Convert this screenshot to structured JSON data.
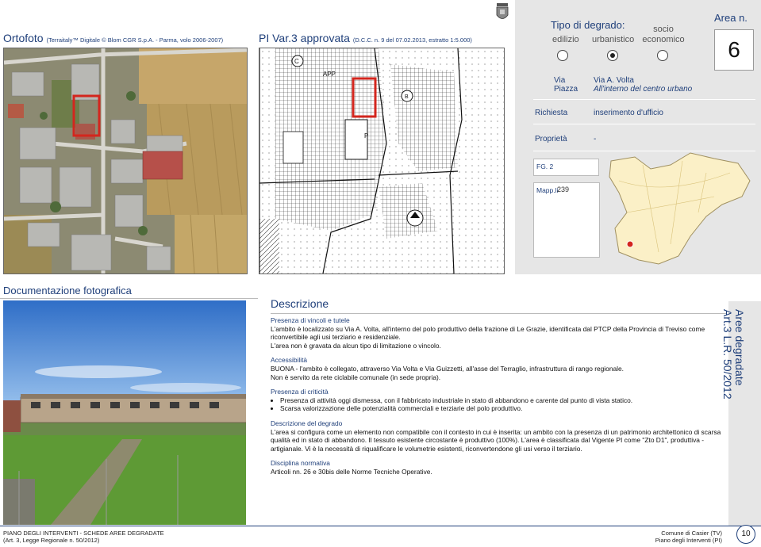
{
  "header": {
    "ortofoto_title": "Ortofoto",
    "ortofoto_sub": "(Terraitaly™ Digitale © Blom CGR S.p.A. - Parma, volo 2006-2007)",
    "pi_title": "PI Var.3 approvata",
    "pi_sub": "(D.C.C. n. 9 del 07.02.2013, estratto 1:5.000)"
  },
  "degrado": {
    "title": "Tipo di degrado:",
    "options": [
      "edilizio",
      "urbanistico",
      "socio\neconomico"
    ],
    "selected_index": 1
  },
  "area": {
    "label": "Area  n.",
    "number": "6"
  },
  "info": {
    "via_label": "Via",
    "piazza_label": "Piazza",
    "via_value": "Via A. Volta",
    "piazza_value": "All'interno del centro urbano",
    "richiesta_label": "Richiesta",
    "richiesta_value": "inserimento d'ufficio",
    "proprieta_label": "Proprietà",
    "proprieta_value": "-",
    "fg_label": "FG. 2",
    "mapp_label": "Mapp.li",
    "mapp_value": "239"
  },
  "sections": {
    "documentazione": "Documentazione fotografica",
    "descrizione": "Descrizione"
  },
  "description": {
    "vincoli_head": "Presenza di vincoli e tutele",
    "vincoli_text": "L'ambito è localizzato su Via A. Volta, all'interno del polo produttivo della frazione di Le Grazie, identificata dal PTCP della Provincia di Treviso come riconvertibile agli usi terziario e residenziale.",
    "vincoli_text2": "L'area non è gravata da alcun tipo di limitazione o vincolo.",
    "accessibilita_head": "Accessibilità",
    "accessibilita_text": "BUONA - l'ambito è collegato, attraverso Via Volta e Via Guizzetti, all'asse del Terraglio, infrastruttura di rango regionale.",
    "accessibilita_text2": "Non è servito da rete ciclabile comunale (in sede propria).",
    "criticita_head": "Presenza di criticità",
    "criticita_items": [
      "Presenza di attività oggi dismessa, con il fabbricato industriale in stato di abbandono e carente dal punto di vista statico.",
      "Scarsa valorizzazione delle potenzialità commerciali e terziarie del polo produttivo."
    ],
    "degrado_head": "Descrizione del degrado",
    "degrado_text": "L'area si configura come un elemento non compatibile con il contesto in cui è inserita: un ambito con la presenza di un patrimonio architettonico di scarsa qualità ed in stato di abbandono. Il tessuto esistente circostante è produttivo (100%). L'area è classificata dal Vigente PI come \"Zto D1\", produttiva - artigianale. Vi è la necessità di riqualificare le volumetrie esistenti, riconvertendone gli usi verso il terziario.",
    "disciplina_head": "Disciplina normativa",
    "disciplina_text": "Articoli nn. 26 e 30bis delle Norme Tecniche Operative."
  },
  "vertical_title": {
    "line1": "Aree degradate",
    "line2": "Art.3 L.R. 50/2012"
  },
  "map_labels": {
    "app": "APP",
    "c": "C",
    "b": "B",
    "p": "P"
  },
  "footer": {
    "left_title": "PIANO DEGLI INTERVENTI - SCHEDE AREE DEGRADATE",
    "left_sub": "(Art. 3, Legge Regionale n. 50/2012)",
    "right_title": "Comune di Casier (TV)",
    "right_sub": "Piano degli Interventi (PI)",
    "page": "10"
  },
  "colors": {
    "accent_blue": "#1f3f7a",
    "highlight_red": "#d3261e",
    "panel_grey": "#e6e6e6",
    "territory_fill": "#fbf0c7"
  }
}
